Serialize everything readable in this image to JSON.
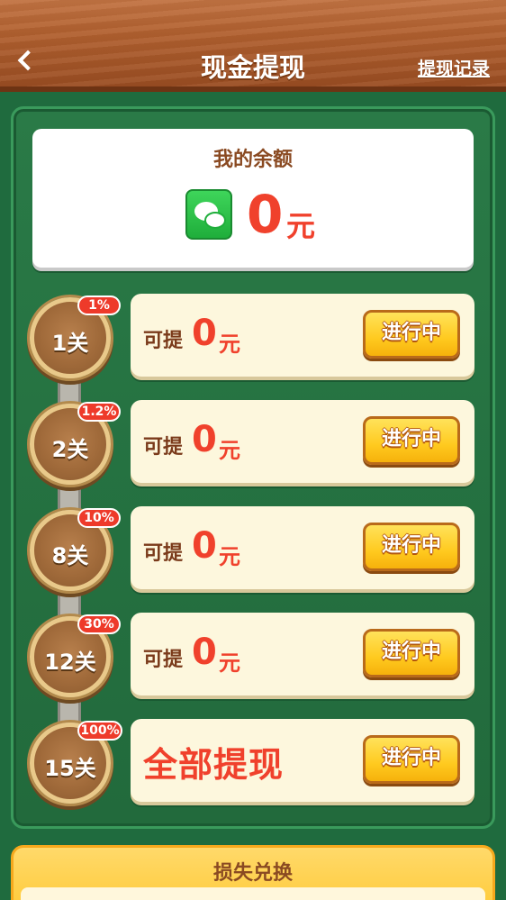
{
  "header": {
    "back_icon": "chevron-left-icon",
    "title": "现金提现",
    "record_link": "提现记录"
  },
  "balance": {
    "title": "我的余额",
    "icon": "wechat-icon",
    "amount": "0",
    "unit": "元"
  },
  "levels": [
    {
      "label": "1关",
      "rate": "1%",
      "prefix": "可提",
      "amount": "0",
      "unit": "元",
      "status": "进行中"
    },
    {
      "label": "2关",
      "rate": "1.2%",
      "prefix": "可提",
      "amount": "0",
      "unit": "元",
      "status": "进行中"
    },
    {
      "label": "8关",
      "rate": "10%",
      "prefix": "可提",
      "amount": "0",
      "unit": "元",
      "status": "进行中"
    },
    {
      "label": "12关",
      "rate": "30%",
      "prefix": "可提",
      "amount": "0",
      "unit": "元",
      "status": "进行中"
    },
    {
      "label": "15关",
      "rate": "100%",
      "full_text": "全部提现",
      "status": "进行中"
    }
  ],
  "loss_panel": {
    "title": "损失兑换"
  },
  "colors": {
    "accent_red": "#f0412c",
    "board_green": "#247040",
    "button_yellow": "#ffca1f",
    "wood_brown": "#b1602f"
  }
}
